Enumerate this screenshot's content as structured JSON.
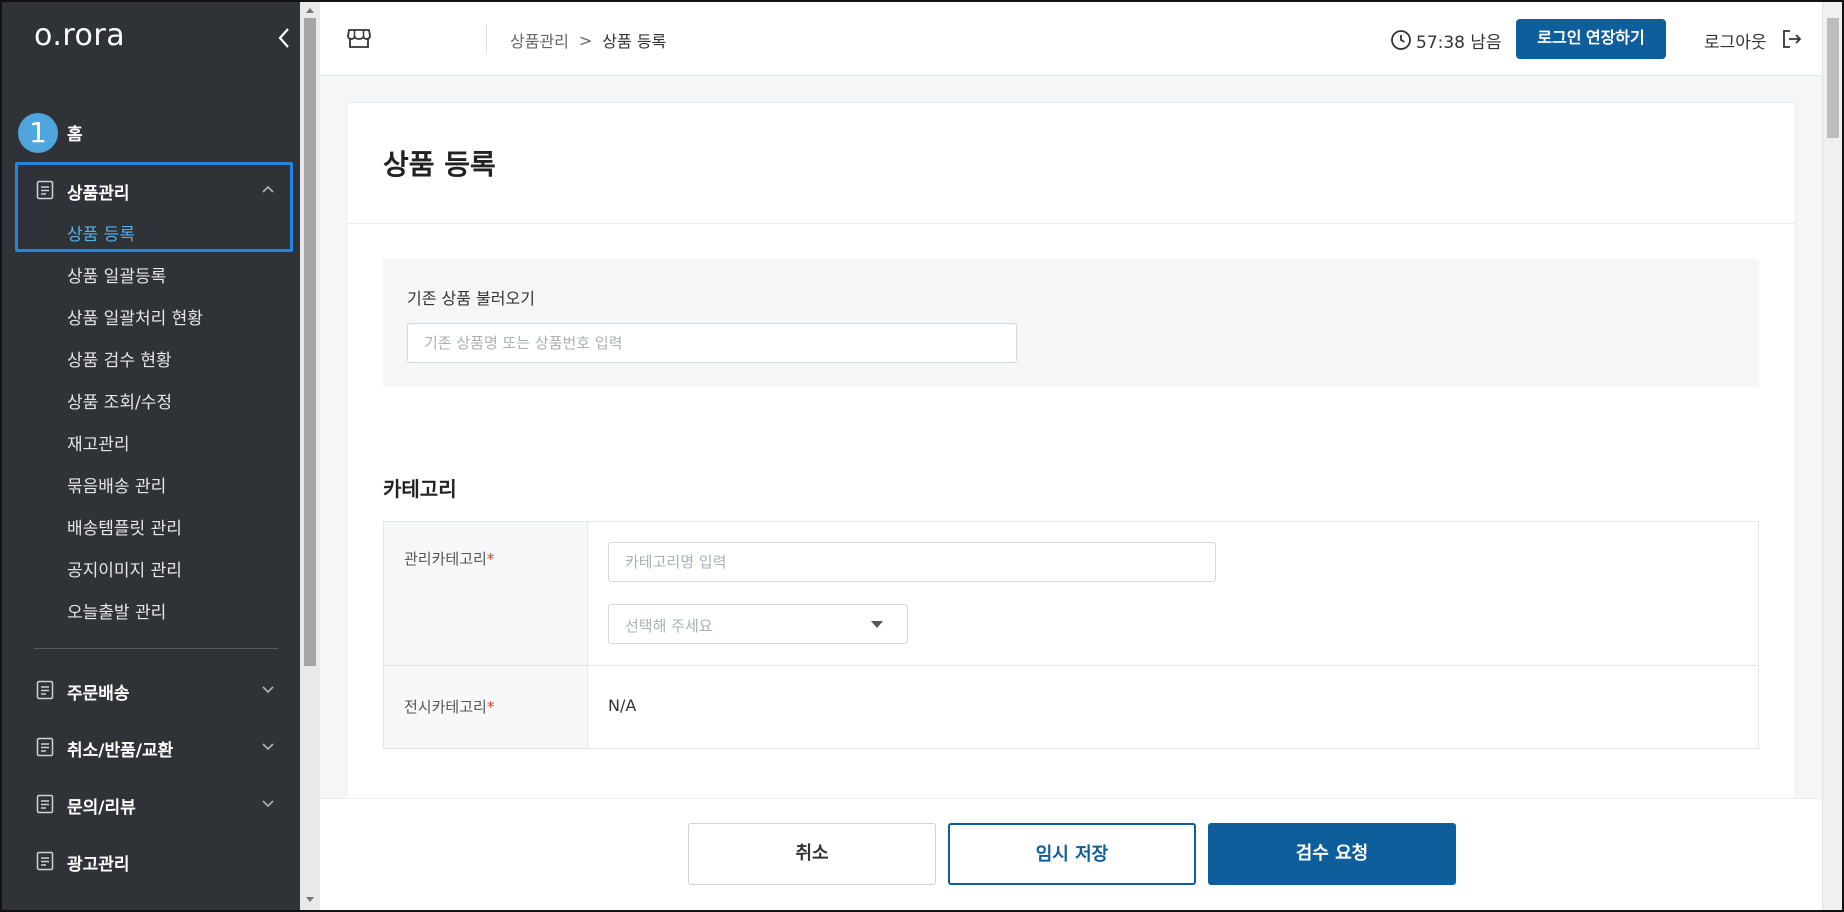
{
  "sidebar": {
    "logo": "o.rora",
    "step_badge": "1",
    "home": "홈",
    "groups": {
      "product": {
        "label": "상품관리"
      },
      "order": {
        "label": "주문배송"
      },
      "cancel": {
        "label": "취소/반품/교환"
      },
      "inquiry": {
        "label": "문의/리뷰"
      },
      "ad": {
        "label": "광고관리"
      }
    },
    "sub_items": [
      "상품 등록",
      "상품 일괄등록",
      "상품 일괄처리 현황",
      "상품 검수 현황",
      "상품 조회/수정",
      "재고관리",
      "묶음배송 관리",
      "배송템플릿 관리",
      "공지이미지 관리",
      "오늘출발 관리"
    ]
  },
  "header": {
    "breadcrumb_parent": "상품관리",
    "breadcrumb_sep": ">",
    "breadcrumb_current": "상품 등록",
    "timer": "57:38 남음",
    "extend_label": "로그인 연장하기",
    "logout_label": "로그아웃"
  },
  "page": {
    "title": "상품 등록",
    "import_label": "기존 상품 불러오기",
    "import_placeholder": "기존 상품명 또는 상품번호 입력",
    "category_title": "카테고리",
    "manage_category_label": "관리카테고리",
    "required_mark": "*",
    "category_placeholder": "카테고리명 입력",
    "select_placeholder": "선택해 주세요",
    "display_category_label": "전시카테고리",
    "display_category_value": "N/A"
  },
  "footer": {
    "cancel": "취소",
    "temp_save": "임시 저장",
    "review_request": "검수 요청"
  },
  "colors": {
    "sidebar_bg": "#2f3338",
    "accent": "#0f5e9c",
    "active_sub": "#4fb0ee",
    "highlight_border": "#1e88e5",
    "step_badge": "#4ea6dd"
  }
}
